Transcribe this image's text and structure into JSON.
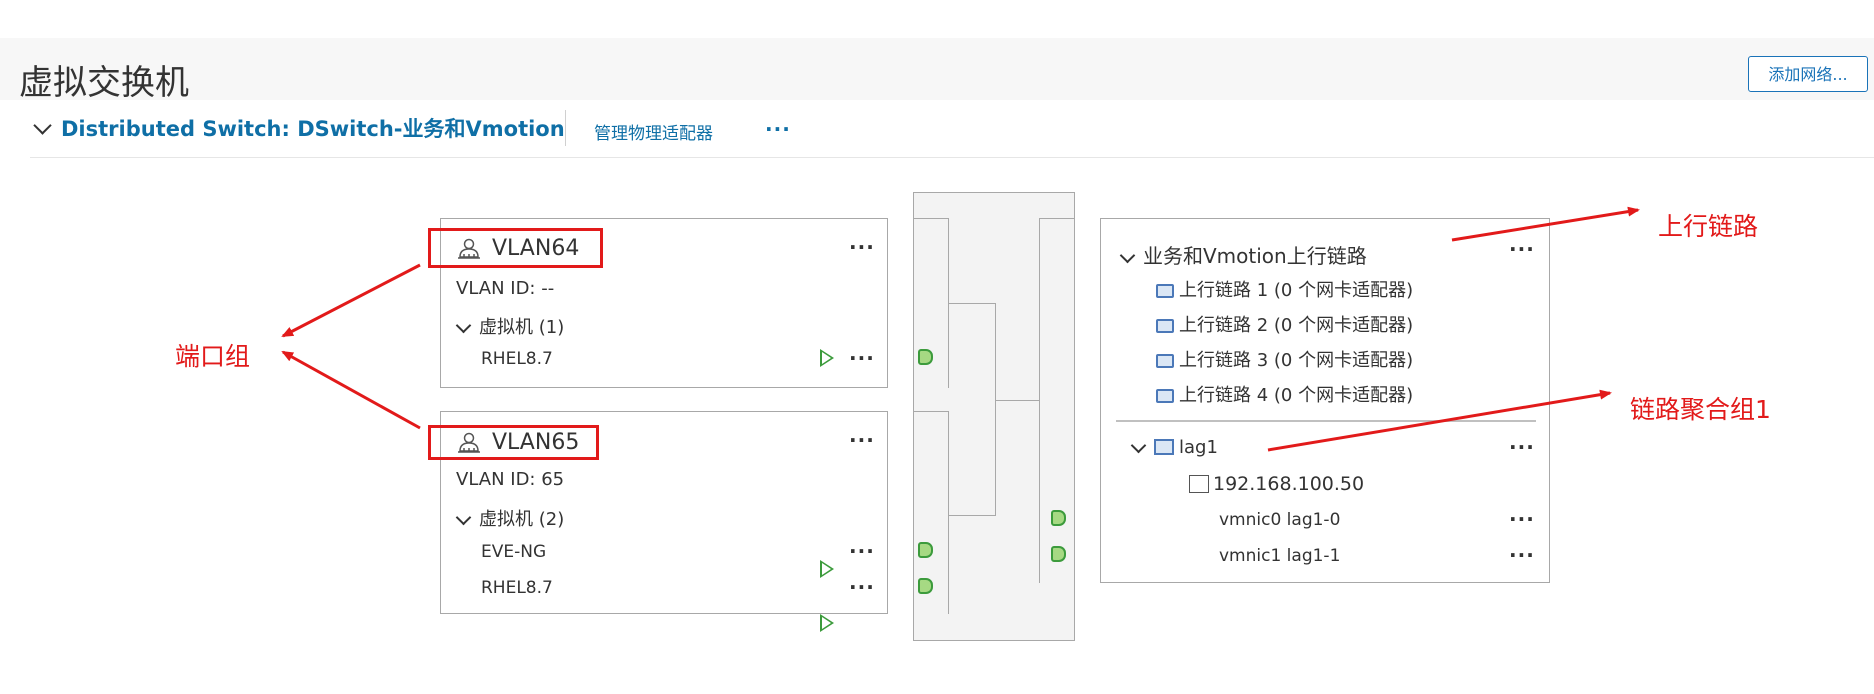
{
  "page": {
    "title": "虚拟交换机",
    "add_network_label": "添加网络..."
  },
  "switch": {
    "label": "Distributed Switch: DSwitch-业务和Vmotion",
    "manage_adapters_label": "管理物理适配器",
    "more_label": "···"
  },
  "port_groups": [
    {
      "name": "VLAN64",
      "vlan_id": "VLAN ID: --",
      "vm_header": "虚拟机 (1)",
      "vms": [
        "RHEL8.7"
      ]
    },
    {
      "name": "VLAN65",
      "vlan_id": "VLAN ID: 65",
      "vm_header": "虚拟机 (2)",
      "vms": [
        "EVE-NG",
        "RHEL8.7"
      ]
    }
  ],
  "uplinks": {
    "group_label": "业务和Vmotion上行链路",
    "items": [
      "上行链路 1 (0 个网卡适配器)",
      "上行链路 2 (0 个网卡适配器)",
      "上行链路 3 (0 个网卡适配器)",
      "上行链路 4 (0 个网卡适配器)"
    ],
    "lag": {
      "name": "lag1",
      "ip": "192.168.100.50",
      "nics": [
        "vmnic0 lag1-0",
        "vmnic1 lag1-1"
      ]
    }
  },
  "annotations": {
    "port_group": "端口组",
    "uplink": "上行链路",
    "lag_group": "链路聚合组1"
  },
  "colors": {
    "link": "#0f6fa6",
    "annotation": "#e21a1a",
    "vm_port": "#3c9b3c",
    "uplink_icon": "#4b78b8"
  }
}
